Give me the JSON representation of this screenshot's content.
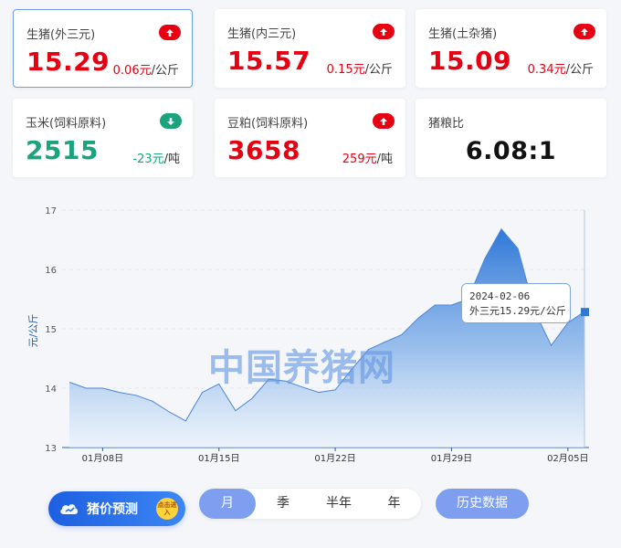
{
  "cards": [
    {
      "label": "生猪(外三元)",
      "value": "15.29",
      "change": "0.06元",
      "unit": "/公斤",
      "trend": "up",
      "active": true
    },
    {
      "label": "生猪(内三元)",
      "value": "15.57",
      "change": "0.15元",
      "unit": "/公斤",
      "trend": "up",
      "active": false
    },
    {
      "label": "生猪(土杂猪)",
      "value": "15.09",
      "change": "0.34元",
      "unit": "/公斤",
      "trend": "up",
      "active": false
    },
    {
      "label": "玉米(饲料原料)",
      "value": "2515",
      "change": "-23元",
      "unit": "/吨",
      "trend": "down",
      "active": false
    },
    {
      "label": "豆粕(饲料原料)",
      "value": "3658",
      "change": "259元",
      "unit": "/吨",
      "trend": "up",
      "active": false
    },
    {
      "label": "猪粮比",
      "value": "6.08:1",
      "change": "",
      "unit": "",
      "trend": "none",
      "active": false
    }
  ],
  "colors": {
    "up": "#e60012",
    "down": "#1aa37c",
    "accent": "#3d84d8",
    "area_top": "#3a7fdc"
  },
  "watermark": "中国养猪网",
  "tooltip": {
    "date": "2024-02-06",
    "text": "外三元15.29元/公斤"
  },
  "predict_button": {
    "label": "猪价预测",
    "badge": "点击进入"
  },
  "periods": [
    {
      "label": "月",
      "selected": true
    },
    {
      "label": "季",
      "selected": false
    },
    {
      "label": "半年",
      "selected": false
    },
    {
      "label": "年",
      "selected": false
    }
  ],
  "history_button": "历史数据",
  "chart_data": {
    "type": "area",
    "title": "",
    "xlabel": "",
    "ylabel": "元/公斤",
    "ylim": [
      13,
      17
    ],
    "yticks": [
      13,
      14,
      15,
      16,
      17
    ],
    "grid": true,
    "xtick_labels": [
      "01月08日",
      "01月15日",
      "01月22日",
      "01月29日",
      "02月05日"
    ],
    "x": [
      "01-06",
      "01-07",
      "01-08",
      "01-09",
      "01-10",
      "01-11",
      "01-12",
      "01-13",
      "01-14",
      "01-15",
      "01-16",
      "01-17",
      "01-18",
      "01-19",
      "01-20",
      "01-21",
      "01-22",
      "01-23",
      "01-24",
      "01-25",
      "01-26",
      "01-27",
      "01-28",
      "01-29",
      "01-30",
      "01-31",
      "02-01",
      "02-02",
      "02-03",
      "02-04",
      "02-05",
      "02-06"
    ],
    "series": [
      {
        "values": [
          14.1,
          14.0,
          14.0,
          13.93,
          13.88,
          13.78,
          13.6,
          13.45,
          13.93,
          14.07,
          13.62,
          13.83,
          14.15,
          14.12,
          14.02,
          13.93,
          13.97,
          14.32,
          14.65,
          14.78,
          14.9,
          15.18,
          15.4,
          15.4,
          15.5,
          16.18,
          16.68,
          16.35,
          15.3,
          14.72,
          15.1,
          15.29
        ]
      }
    ]
  }
}
